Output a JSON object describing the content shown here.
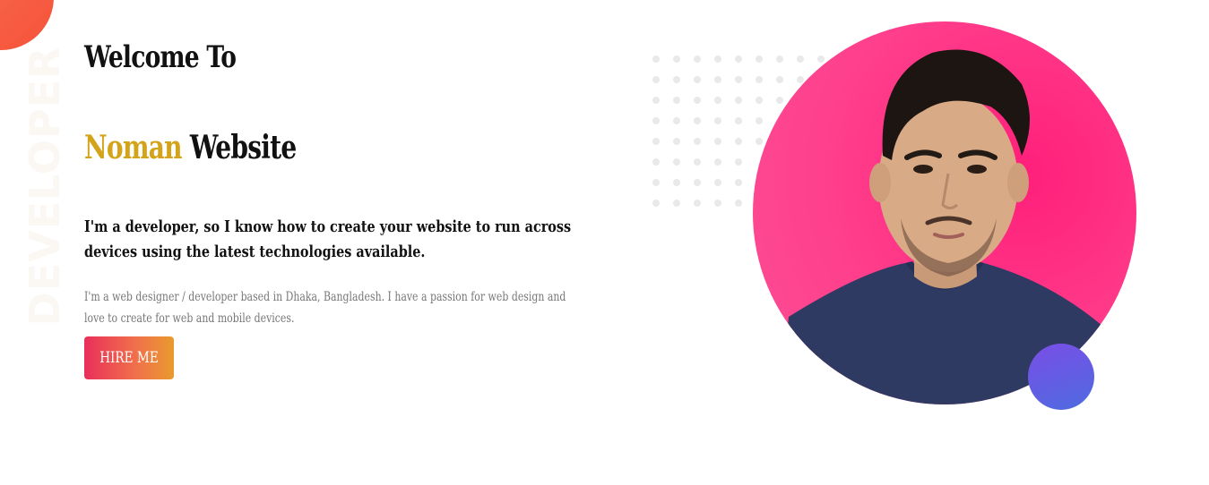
{
  "hero": {
    "vertical_word": "DEVELOPER",
    "welcome": "Welcome To",
    "name": "Noman",
    "name_suffix": "Website",
    "headline": "I'm a developer, so I know how to create your website to run across devices using the latest technologies available.",
    "subtext": "I'm a web designer / developer based in Dhaka, Bangladesh. I have a passion for web design and love to create for web and mobile devices.",
    "cta_label": "HIRE ME"
  },
  "colors": {
    "accent_name": "#d3a31a",
    "portrait_bg": "#ff3f8c",
    "button_gradient_start": "#ea2f5a",
    "button_gradient_end": "#e99a2e",
    "accent_circle": "#6a5ae3",
    "corner_blob": "#f5523a"
  },
  "images": {
    "portrait": "profile-photo"
  }
}
